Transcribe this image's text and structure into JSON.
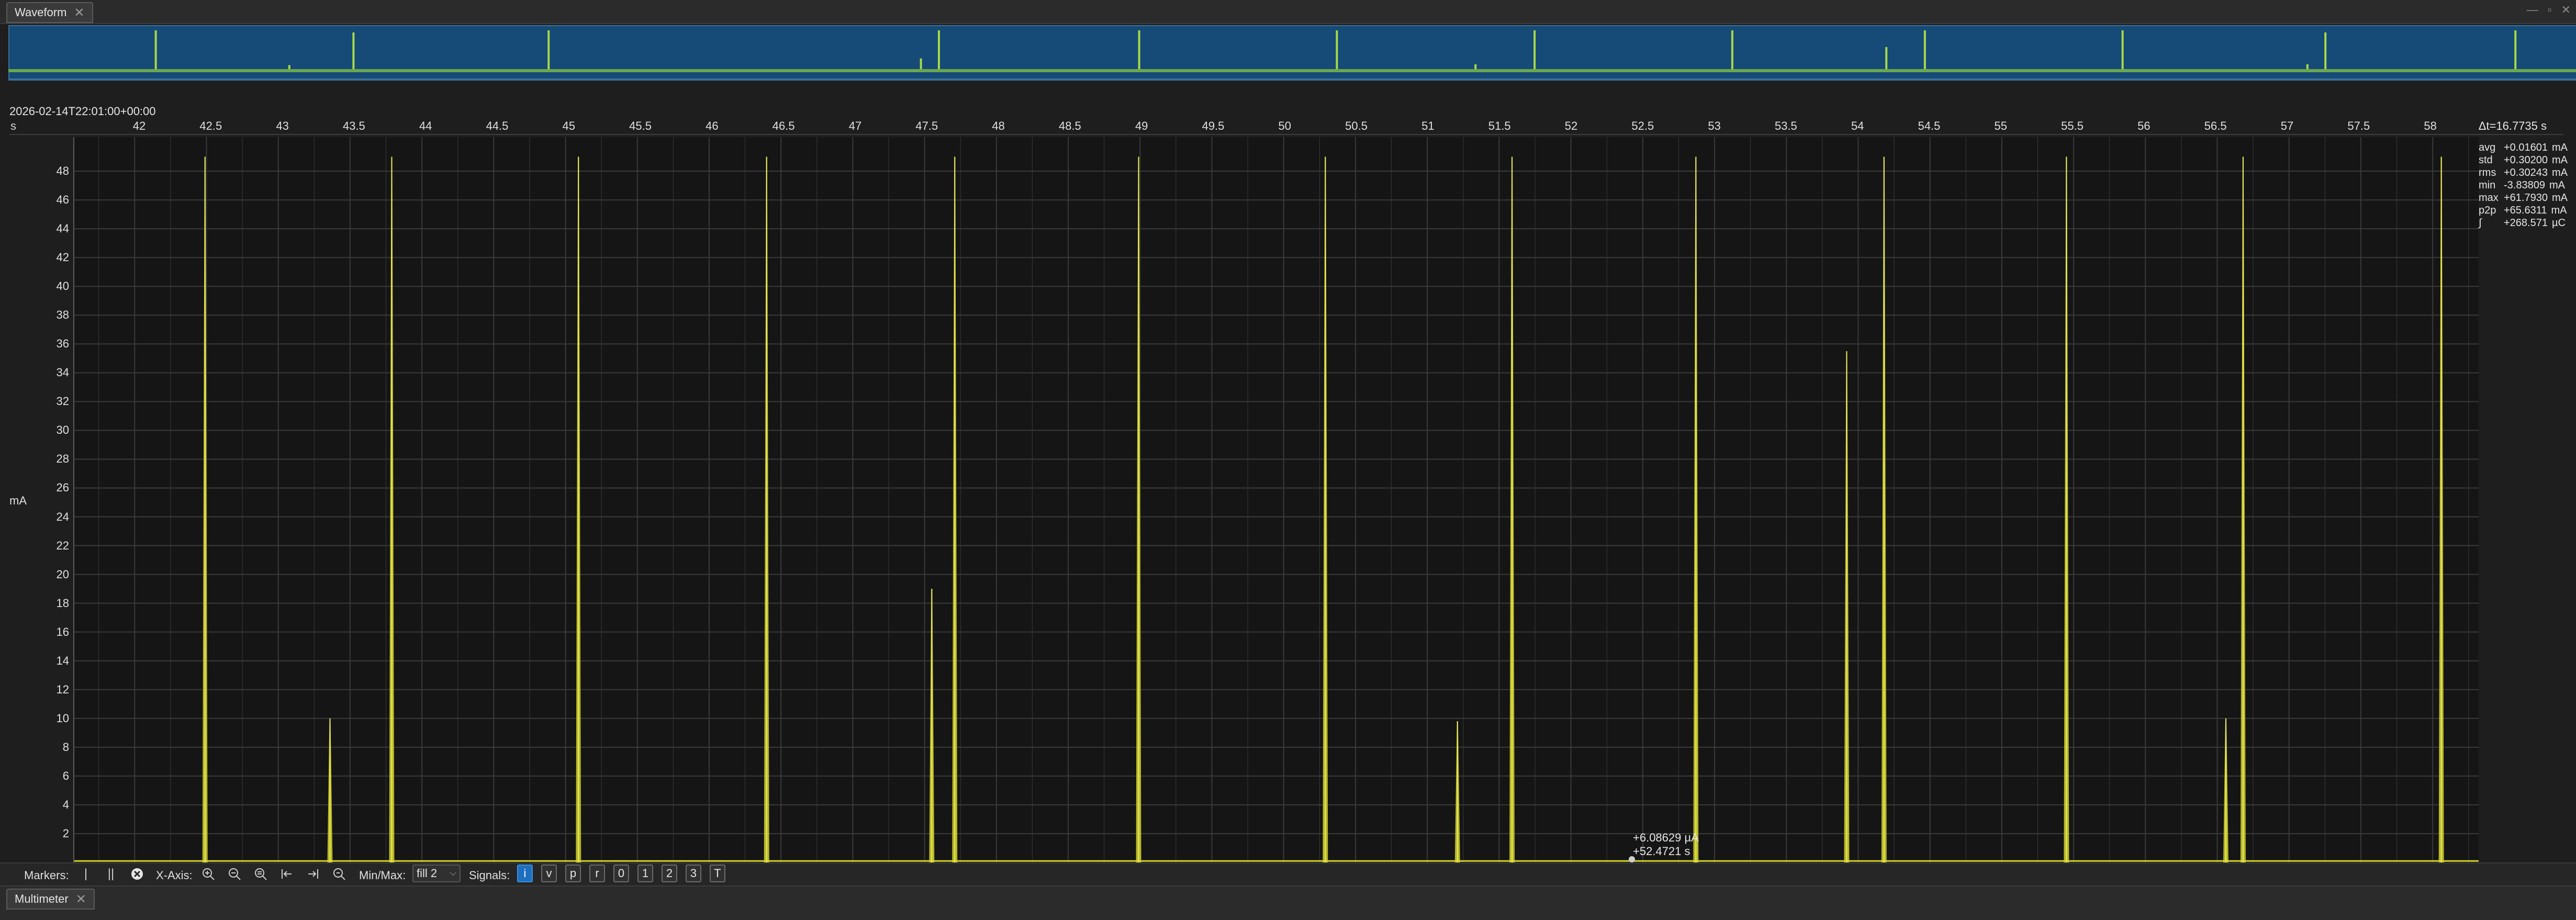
{
  "tabs": {
    "waveform": "Waveform",
    "multimeter": "Multimeter",
    "close_glyph": "✕"
  },
  "window_controls": [
    "—",
    "▫",
    "✕"
  ],
  "timestamp": "2026-02-14T22:01:00+00:00",
  "x_axis": {
    "unit": "s",
    "ticks": [
      "42",
      "42.5",
      "43",
      "43.5",
      "44",
      "44.5",
      "45",
      "45.5",
      "46",
      "46.5",
      "47",
      "47.5",
      "48",
      "48.5",
      "49",
      "49.5",
      "50",
      "50.5",
      "51",
      "51.5",
      "52",
      "52.5",
      "53",
      "53.5",
      "54",
      "54.5",
      "55",
      "55.5",
      "56",
      "56.5",
      "57",
      "57.5",
      "58"
    ],
    "delta_label": "Δt=16.7735 s"
  },
  "y_axis": {
    "unit": "mA",
    "ticks": [
      "2",
      "4",
      "6",
      "8",
      "10",
      "12",
      "14",
      "16",
      "18",
      "20",
      "22",
      "24",
      "26",
      "28",
      "30",
      "32",
      "34",
      "36",
      "38",
      "40",
      "42",
      "44",
      "46",
      "48"
    ]
  },
  "stats": [
    {
      "k": "avg",
      "v": "+0.01601",
      "u": "mA"
    },
    {
      "k": "std",
      "v": "+0.30200",
      "u": "mA"
    },
    {
      "k": "rms",
      "v": "+0.30243",
      "u": "mA"
    },
    {
      "k": "min",
      "v": "-3.83809",
      "u": "mA"
    },
    {
      "k": "max",
      "v": "+61.7930",
      "u": "mA"
    },
    {
      "k": "p2p",
      "v": "+65.6311",
      "u": "mA"
    },
    {
      "k": "∫",
      "v": "+268.571",
      "u": "µC"
    }
  ],
  "cursor": {
    "value": "+6.08629 µA",
    "time": "+52.4721 s"
  },
  "toolbar": {
    "markers_label": "Markers:",
    "xaxis_label": "X-Axis:",
    "minmax_label": "Min/Max:",
    "minmax_value": "fill 2",
    "signals_label": "Signals:",
    "signals": [
      "i",
      "v",
      "p",
      "r",
      "0",
      "1",
      "2",
      "3",
      "T"
    ],
    "active_signal": "i"
  },
  "colors": {
    "trace": "#d4d42a",
    "trace_glow": "#f0f06a",
    "grid": "#3a3a3a",
    "overview_bg": "#164a77",
    "overview_trace": "#a8d84a",
    "accent": "#1f6fbf"
  },
  "chart_data": {
    "type": "line",
    "title": "",
    "xlabel": "s",
    "ylabel": "mA",
    "xlim": [
      41.58,
      58.32
    ],
    "ylim": [
      0,
      50
    ],
    "grid": true,
    "spikes": [
      {
        "x": 42.49,
        "y": 49.0
      },
      {
        "x": 43.36,
        "y": 10.0
      },
      {
        "x": 43.79,
        "y": 49.0
      },
      {
        "x": 45.09,
        "y": 49.0
      },
      {
        "x": 46.4,
        "y": 49.0
      },
      {
        "x": 47.55,
        "y": 19.0
      },
      {
        "x": 47.71,
        "y": 49.0
      },
      {
        "x": 48.99,
        "y": 49.0
      },
      {
        "x": 50.29,
        "y": 49.0
      },
      {
        "x": 51.21,
        "y": 9.8
      },
      {
        "x": 51.59,
        "y": 49.0
      },
      {
        "x": 52.87,
        "y": 49.0
      },
      {
        "x": 53.92,
        "y": 35.5
      },
      {
        "x": 54.18,
        "y": 49.0
      },
      {
        "x": 55.45,
        "y": 49.0
      },
      {
        "x": 56.56,
        "y": 10.0
      },
      {
        "x": 56.68,
        "y": 49.0
      },
      {
        "x": 58.06,
        "y": 49.0
      }
    ]
  },
  "overview_data": {
    "spikes": [
      {
        "x": 0.057,
        "h": 0.95
      },
      {
        "x": 0.109,
        "h": 0.12
      },
      {
        "x": 0.134,
        "h": 0.9
      },
      {
        "x": 0.21,
        "h": 0.95
      },
      {
        "x": 0.355,
        "h": 0.28
      },
      {
        "x": 0.362,
        "h": 0.95
      },
      {
        "x": 0.44,
        "h": 0.95
      },
      {
        "x": 0.517,
        "h": 0.95
      },
      {
        "x": 0.571,
        "h": 0.14
      },
      {
        "x": 0.594,
        "h": 0.95
      },
      {
        "x": 0.671,
        "h": 0.95
      },
      {
        "x": 0.731,
        "h": 0.55
      },
      {
        "x": 0.746,
        "h": 0.95
      },
      {
        "x": 0.823,
        "h": 0.95
      },
      {
        "x": 0.895,
        "h": 0.14
      },
      {
        "x": 0.902,
        "h": 0.9
      },
      {
        "x": 0.976,
        "h": 0.95
      }
    ]
  }
}
